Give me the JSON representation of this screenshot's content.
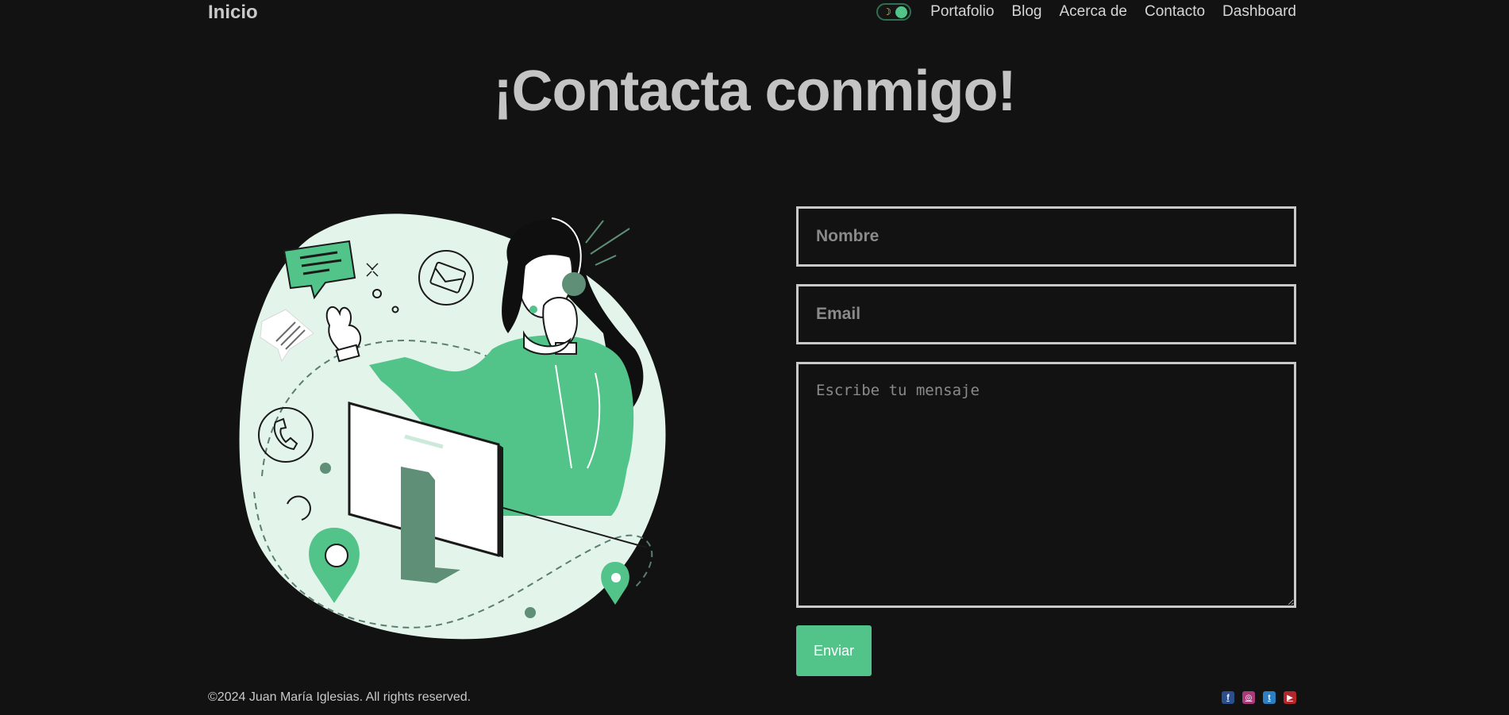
{
  "header": {
    "brand": "Inicio",
    "nav": [
      "Portafolio",
      "Blog",
      "Acerca de",
      "Contacto",
      "Dashboard"
    ],
    "theme_toggle_icon": "moon-icon"
  },
  "main": {
    "title": "¡Contacta conmigo!",
    "illustration": "customer-support-illustration",
    "form": {
      "name_placeholder": "Nombre",
      "email_placeholder": "Email",
      "message_placeholder": "Escribe tu mensaje",
      "submit_label": "Enviar"
    }
  },
  "footer": {
    "copyright": "©2024 Juan María Iglesias. All rights reserved.",
    "social_icons": [
      "facebook-icon",
      "instagram-icon",
      "twitter-icon",
      "youtube-icon"
    ]
  },
  "colors": {
    "background": "#121212",
    "accent": "#52c48a",
    "text": "#c9c9c9"
  }
}
